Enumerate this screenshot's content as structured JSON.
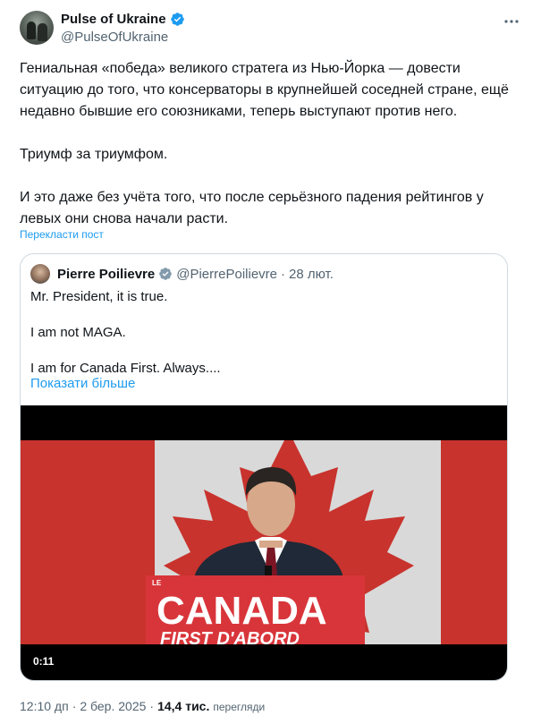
{
  "author": {
    "name": "Pulse of Ukraine",
    "handle": "@PulseOfUkraine",
    "avatar_icon": "avatar-photo",
    "verified_color": "#1d9bf0"
  },
  "tweet": {
    "text": "Гениальная «победа» великого стратега из Нью-Йорка — довести ситуацию до того, что консерваторы в крупнейшей соседней стране, ещё недавно бывшие его союзниками, теперь выступают против него.\n\nТриумф за триумфом.\n\nИ это даже без учёта того, что после серьёзного падения рейтингов у левых они снова начали расти.",
    "translate_label": "Перекласти пост"
  },
  "quoted": {
    "name": "Pierre Poilievre",
    "handle": "@PierrePoilievre",
    "separator": "·",
    "date": "28 лют.",
    "text": "Mr. President, it is true.\n\nI am not MAGA.\n\nI am for Canada First. Always....",
    "show_more_label": "Показати більше",
    "video": {
      "duration": "0:11",
      "podium_small": "LE",
      "podium_main": "CANADA",
      "podium_sub": "FIRST  D'ABORD",
      "flag_color": "#c8332d",
      "podium_color": "#d8353a"
    }
  },
  "meta": {
    "time": "12:10 дп",
    "separator": "·",
    "date": "2 бер. 2025",
    "separator2": "·",
    "views_count": "14,4 тис.",
    "views_label": "перегляди"
  }
}
